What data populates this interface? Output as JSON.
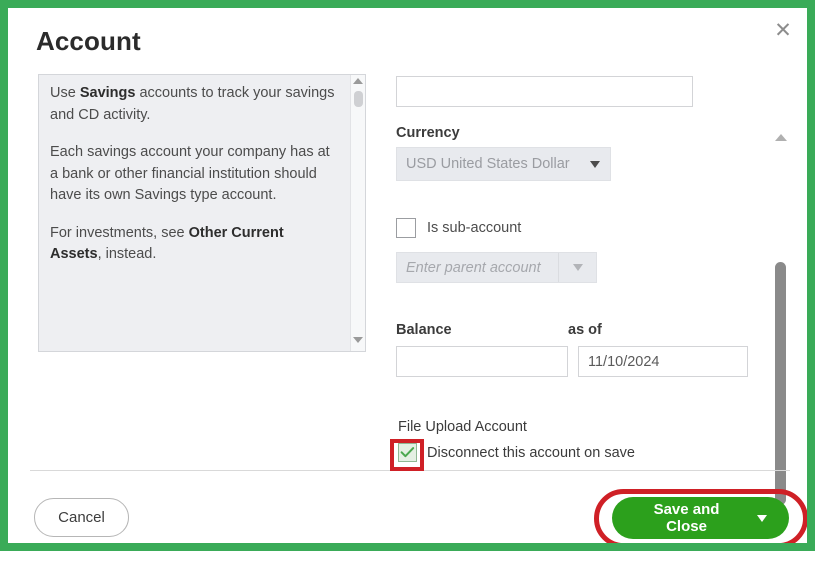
{
  "window": {
    "title": "Account",
    "border_color": "#3aab58",
    "close_icon": "✕"
  },
  "info_panel": {
    "paragraphs": [
      {
        "prefix": "Use ",
        "bold": "Savings",
        "suffix": " accounts to track your savings and CD activity."
      },
      {
        "prefix": "Each savings account your company has at a bank or other financial institution should have its own Savings type account.",
        "bold": "",
        "suffix": ""
      },
      {
        "prefix": "For investments, see ",
        "bold": "Other Current Assets",
        "suffix": ", instead."
      }
    ],
    "scrollbar": {
      "up_icon": "triangle-up-icon",
      "down_icon": "triangle-down-icon"
    }
  },
  "form": {
    "top_field": {
      "label": "",
      "value": "",
      "placeholder": ""
    },
    "currency": {
      "label": "Currency",
      "value": "USD United States Dollar",
      "disabled": true,
      "caret_icon": "chevron-down-icon"
    },
    "sub_account": {
      "label": "Is sub-account",
      "checked": false
    },
    "parent_account": {
      "placeholder": "Enter parent account",
      "value": "",
      "disabled": true,
      "caret_icon": "chevron-down-icon"
    },
    "balance": {
      "label": "Balance",
      "value": "",
      "placeholder": ""
    },
    "as_of": {
      "label": "as of",
      "value": "11/10/2024",
      "placeholder": ""
    },
    "file_upload": {
      "heading": "File Upload Account",
      "disconnect_label": "Disconnect this account on save",
      "disconnect_checked": true,
      "check_icon": "checkmark-icon",
      "check_color": "#4aa84e",
      "highlight_color": "#cf2026"
    }
  },
  "scrollbar": {
    "up_icon": "triangle-up-icon",
    "down_icon": "triangle-down-icon"
  },
  "footer": {
    "cancel_label": "Cancel",
    "save_label": "Save and Close",
    "save_caret_icon": "chevron-down-icon",
    "save_color": "#2ca01c",
    "highlight_color": "#cf2026"
  }
}
